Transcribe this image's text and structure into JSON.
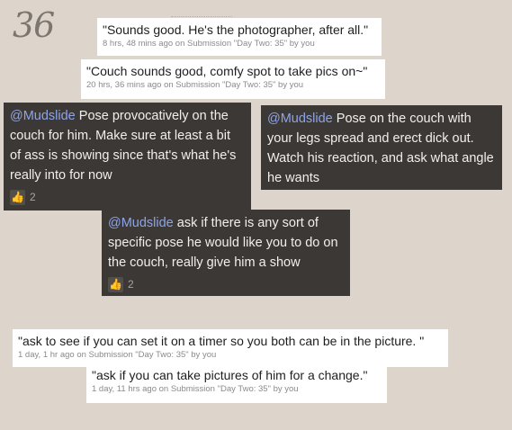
{
  "page_number": "36",
  "comments": [
    {
      "quote": "\"Sounds good. He's the photographer, after all.\"",
      "meta": "8 hrs, 48 mins ago on Submission \"Day Two: 35\" by you"
    },
    {
      "quote": "\"Couch sounds good, comfy spot to take pics on~\"",
      "meta": "20 hrs, 36 mins ago on Submission \"Day Two: 35\" by you"
    },
    {
      "quote": "\"ask to see if you can set it on a timer so you both can be in the picture. \"",
      "meta": "1 day, 1 hr ago on Submission \"Day Two: 35\" by you"
    },
    {
      "quote": "\"ask if you can take pictures of him for a change.\"",
      "meta": "1 day, 11 hrs ago on Submission \"Day Two: 35\" by you"
    }
  ],
  "suggestions": [
    {
      "mention": "@Mudslide",
      "text": " Pose provocatively on the couch for him.  Make sure at least a bit of ass is showing since that's what he's really into for now",
      "likes": "2",
      "thumb_icon": "thumbs-up-icon"
    },
    {
      "mention": "@Mudslide",
      "text": " Pose on the couch with your legs spread and erect dick out.  Watch his reaction, and ask what angle he wants"
    },
    {
      "mention": "@Mudslide",
      "text": "  ask if there is any sort of specific pose he would like you to do on the couch, really give him a show",
      "likes": "2",
      "thumb_icon": "thumbs-up-icon"
    }
  ],
  "colors": {
    "background": "#ddd5cb",
    "dark_card": "#3b3835",
    "mention": "#8ea4e6"
  }
}
